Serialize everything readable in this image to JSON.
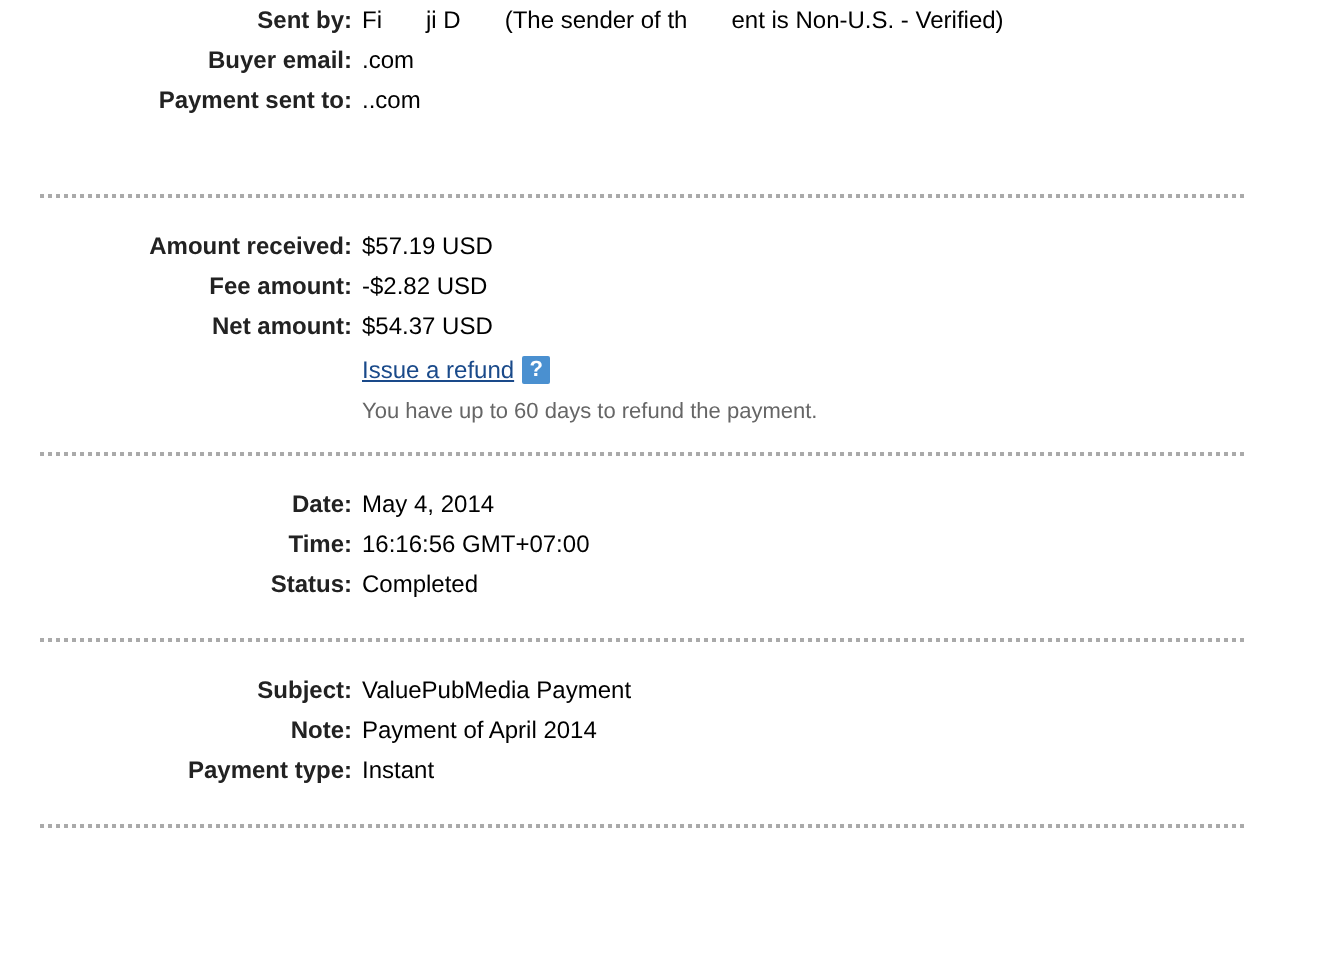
{
  "sections": [
    {
      "rows": [
        {
          "label": "Sent by:",
          "fragments": [
            "Fi",
            "ji D",
            "(The sender of th",
            "ent is Non-U.S. - Verified)"
          ]
        },
        {
          "label": "Buyer email:",
          "fragments": [
            ".com"
          ]
        },
        {
          "label": "Payment sent to:",
          "fragments": [
            "..com"
          ]
        }
      ]
    },
    {
      "rows": [
        {
          "label": "Amount received:",
          "fragments": [
            "$57.19 USD"
          ]
        },
        {
          "label": "Fee amount:",
          "fragments": [
            "-$2.82 USD"
          ]
        },
        {
          "label": "Net amount:",
          "fragments": [
            "$54.37 USD"
          ]
        }
      ],
      "refund": {
        "link": "Issue a refund",
        "help": "?",
        "note": "You have up to 60 days to refund the payment."
      }
    },
    {
      "rows": [
        {
          "label": "Date:",
          "fragments": [
            "May 4, 2014"
          ]
        },
        {
          "label": "Time:",
          "fragments": [
            "16:16:56 GMT+07:00"
          ]
        },
        {
          "label": "Status:",
          "fragments": [
            "Completed"
          ]
        }
      ]
    },
    {
      "rows": [
        {
          "label": "Subject:",
          "fragments": [
            "ValuePubMedia Payment"
          ]
        },
        {
          "label": "Note:",
          "fragments": [
            "Payment of April 2014"
          ]
        },
        {
          "label": "Payment type:",
          "fragments": [
            "Instant"
          ]
        }
      ]
    }
  ]
}
